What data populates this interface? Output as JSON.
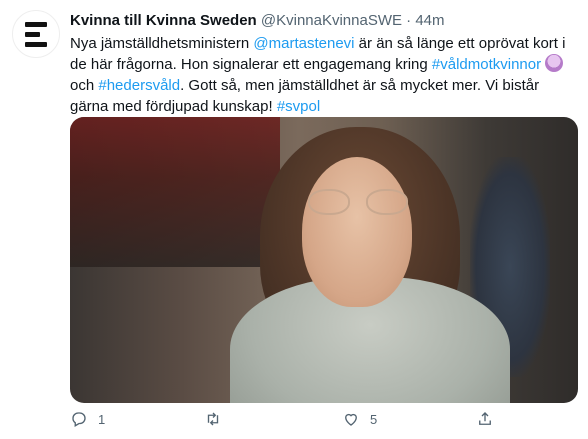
{
  "tweet": {
    "author_name": "Kvinna till Kvinna Sweden",
    "handle": "@KvinnaKvinnaSWE",
    "separator": "·",
    "time": "44m",
    "text": {
      "p1": "Nya jämställdhetsministern ",
      "mention": "@martastenevi",
      "p2": " är än så länge ett oprövat kort i de här frågorna. Hon signalerar ett engagemang kring ",
      "tag1": "#våldmotkvinnor",
      "p3": " och ",
      "tag2": "#hedersvåld",
      "p4": ". Gott så, men jämställdhet är så mycket mer. Vi bistår gärna med fördjupad kunskap! ",
      "tag3": "#svpol"
    },
    "emoji_icon": "woman-emoji-icon"
  },
  "actions": {
    "reply_count": "1",
    "retweet_count": "",
    "like_count": "5",
    "icons": [
      "reply-icon",
      "retweet-icon",
      "like-icon",
      "share-icon"
    ]
  },
  "colors": {
    "link": "#1d9bf0",
    "muted": "#536471",
    "text": "#0f1419"
  }
}
